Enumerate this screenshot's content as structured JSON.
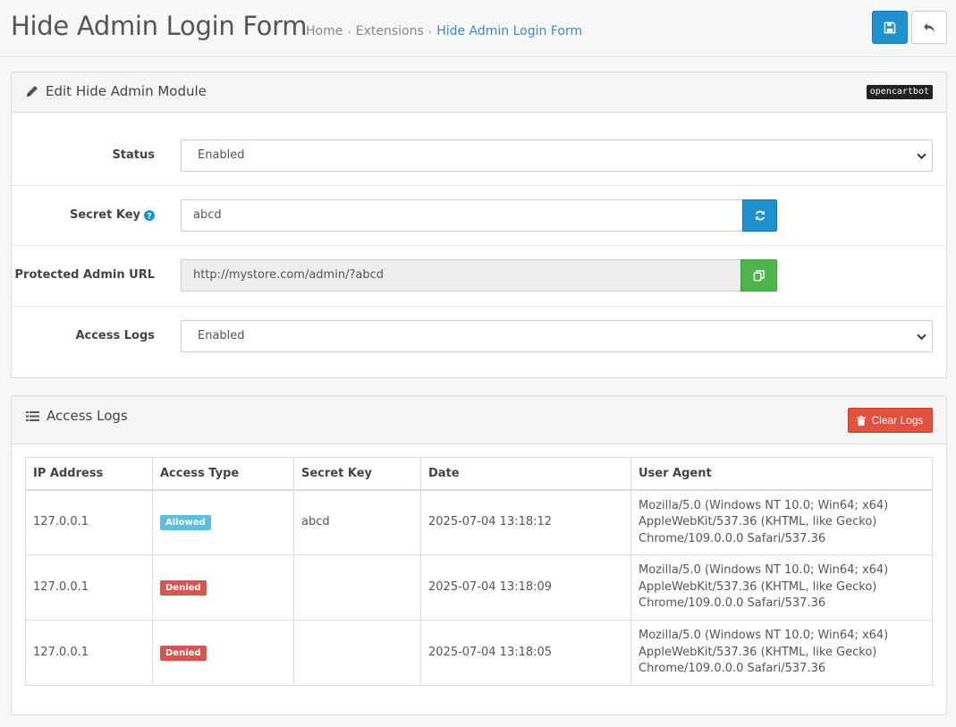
{
  "header": {
    "title": "Hide Admin Login Form",
    "breadcrumb": [
      {
        "label": "Home"
      },
      {
        "label": "Extensions"
      },
      {
        "label": "Hide Admin Login Form"
      }
    ]
  },
  "edit_panel": {
    "title": "Edit Hide Admin Module",
    "badge": "opencartbot",
    "fields": {
      "status": {
        "label": "Status",
        "value": "Enabled"
      },
      "secret_key": {
        "label": "Secret Key",
        "value": "abcd"
      },
      "protected_url": {
        "label": "Protected Admin URL",
        "value": "http://mystore.com/admin/?abcd"
      },
      "access_logs": {
        "label": "Access Logs",
        "value": "Enabled"
      }
    }
  },
  "logs_panel": {
    "title": "Access Logs",
    "clear_label": "Clear Logs",
    "columns": [
      "IP Address",
      "Access Type",
      "Secret Key",
      "Date",
      "User Agent"
    ],
    "rows": [
      {
        "ip": "127.0.0.1",
        "type": "Allowed",
        "key": "abcd",
        "date": "2025-07-04 13:18:12",
        "ua1": "Mozilla/5.0 (Windows NT 10.0; Win64; x64)",
        "ua2": "AppleWebKit/537.36 (KHTML, like Gecko)",
        "ua3": "Chrome/109.0.0.0 Safari/537.36"
      },
      {
        "ip": "127.0.0.1",
        "type": "Denied",
        "key": "",
        "date": "2025-07-04 13:18:09",
        "ua1": "Mozilla/5.0 (Windows NT 10.0; Win64; x64)",
        "ua2": "AppleWebKit/537.36 (KHTML, like Gecko)",
        "ua3": "Chrome/109.0.0.0 Safari/537.36"
      },
      {
        "ip": "127.0.0.1",
        "type": "Denied",
        "key": "",
        "date": "2025-07-04 13:18:05",
        "ua1": "Mozilla/5.0 (Windows NT 10.0; Win64; x64)",
        "ua2": "AppleWebKit/537.36 (KHTML, like Gecko)",
        "ua3": "Chrome/109.0.0.0 Safari/537.36"
      }
    ]
  },
  "colors": {
    "primary": "#1e91cf",
    "success": "#4cb64c",
    "danger": "#e3503e",
    "info_label": "#5bc0de",
    "danger_label": "#d9534f"
  }
}
